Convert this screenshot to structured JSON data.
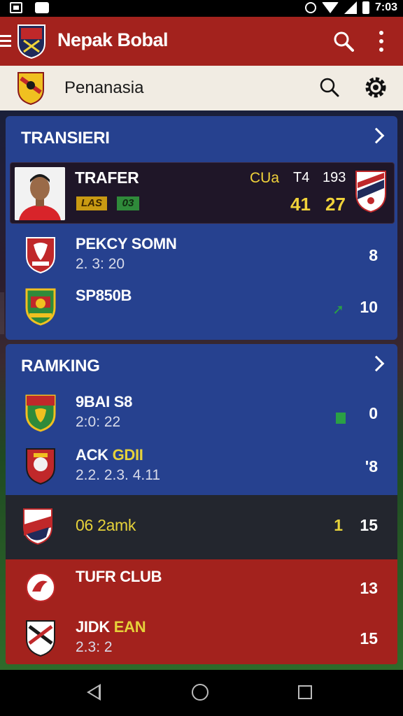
{
  "status_bar": {
    "time": "7:03"
  },
  "app_bar": {
    "title": "Nepak Bobal",
    "search_icon": "search-icon",
    "more_icon": "more-vert-icon"
  },
  "sub_bar": {
    "title": "Penanasia",
    "search_icon": "search-icon",
    "settings_icon": "gear-icon"
  },
  "transfer_section": {
    "title": "TRANSIERI",
    "featured": {
      "name": "TRAFER",
      "tag1": "LAS",
      "tag2": "03",
      "stat_label": "CUa",
      "stat_a": "T4",
      "stat_b": "193",
      "value_a": "41",
      "value_b": "27"
    },
    "rows": [
      {
        "name": "PEKCY SOMN",
        "sub": "2. 3: 20",
        "value": "8"
      },
      {
        "name": "SP850B",
        "sub": "",
        "value": "10"
      }
    ]
  },
  "ranking_section": {
    "title": "RAMKING",
    "rows": [
      {
        "name": "9BAI S8",
        "sub": "2:0: 22",
        "value": "0"
      },
      {
        "name": "ACK GDII",
        "sub": "2.2. 2.3. 4.11",
        "value": "'8"
      }
    ],
    "highlight": {
      "name": "06 2amk",
      "value_a": "1",
      "value_b": "15"
    }
  },
  "red_section": {
    "rows": [
      {
        "name": "TUFR CLUB",
        "sub": "",
        "value": "13"
      },
      {
        "name": "JIDK EAN",
        "sub": "2.3: 2",
        "value": "15"
      }
    ]
  },
  "colors": {
    "app_bar": "#a3221d",
    "card_blue": "#26418f",
    "accent_yellow": "#f0d23a",
    "accent_green": "#2aa045"
  }
}
